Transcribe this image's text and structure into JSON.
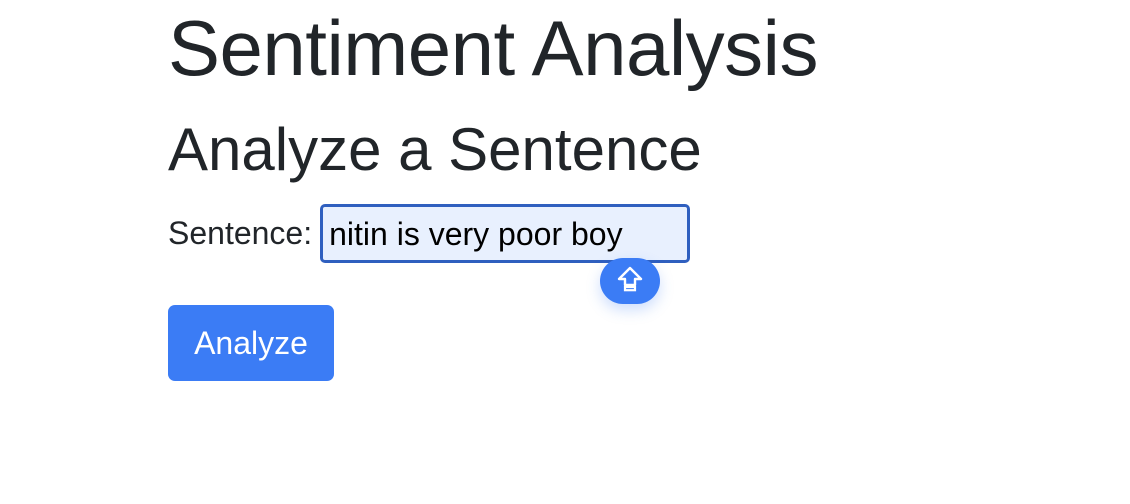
{
  "header": {
    "title": "Sentiment Analysis"
  },
  "form": {
    "heading": "Analyze a Sentence",
    "sentence_label": "Sentence:",
    "sentence_value": "nitin is very poor boy",
    "submit_label": "Analyze"
  },
  "overlay": {
    "icon": "shift-arrow-icon"
  },
  "colors": {
    "accent": "#3b7cf5",
    "input_border": "#2f5fbf",
    "input_bg": "#e8f0fe",
    "text": "#212529"
  }
}
